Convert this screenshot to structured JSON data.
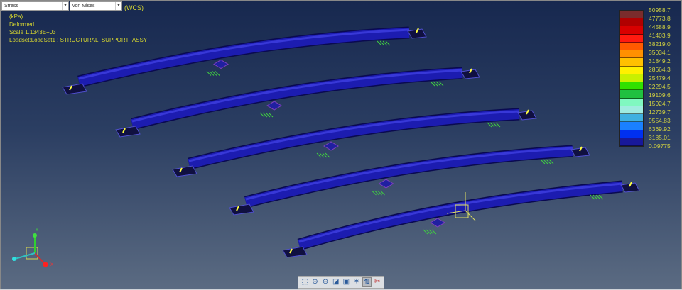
{
  "toolbar_top": {
    "result_type": "Stress",
    "component": "von Mises",
    "coord_system": "(WCS)"
  },
  "info": {
    "units": "(kPa)",
    "state": "Deformed",
    "scale": "Scale  1.1343E+03",
    "loadset": "Loadset:LoadSet1 :  STRUCTURAL_SUPPORT_ASSY"
  },
  "legend": {
    "labels": [
      "50958.7",
      "47773.8",
      "44588.9",
      "41403.9",
      "38219.0",
      "35034.1",
      "31849.2",
      "28664.3",
      "25479.4",
      "22294.5",
      "19109.6",
      "15924.7",
      "12739.7",
      "9554.83",
      "6369.92",
      "3185.01",
      "0.09775"
    ],
    "colors": [
      "#7a2c2c",
      "#b00000",
      "#d80000",
      "#ff1a10",
      "#ff5a00",
      "#ff9000",
      "#ffc000",
      "#fff000",
      "#c8f000",
      "#30e000",
      "#20c040",
      "#80f8c0",
      "#a0ece0",
      "#40b0e0",
      "#1a80ff",
      "#0030f0",
      "#18189a"
    ]
  },
  "triad": {
    "y": "Y",
    "x": "X"
  },
  "bottom_toolbar": [
    "zoom-fit",
    "zoom-in",
    "zoom-out",
    "view-plane",
    "refit",
    "spin",
    "orient",
    "pan"
  ],
  "colors": {
    "beam": "#1c1cb0",
    "text": "#d6d630"
  }
}
